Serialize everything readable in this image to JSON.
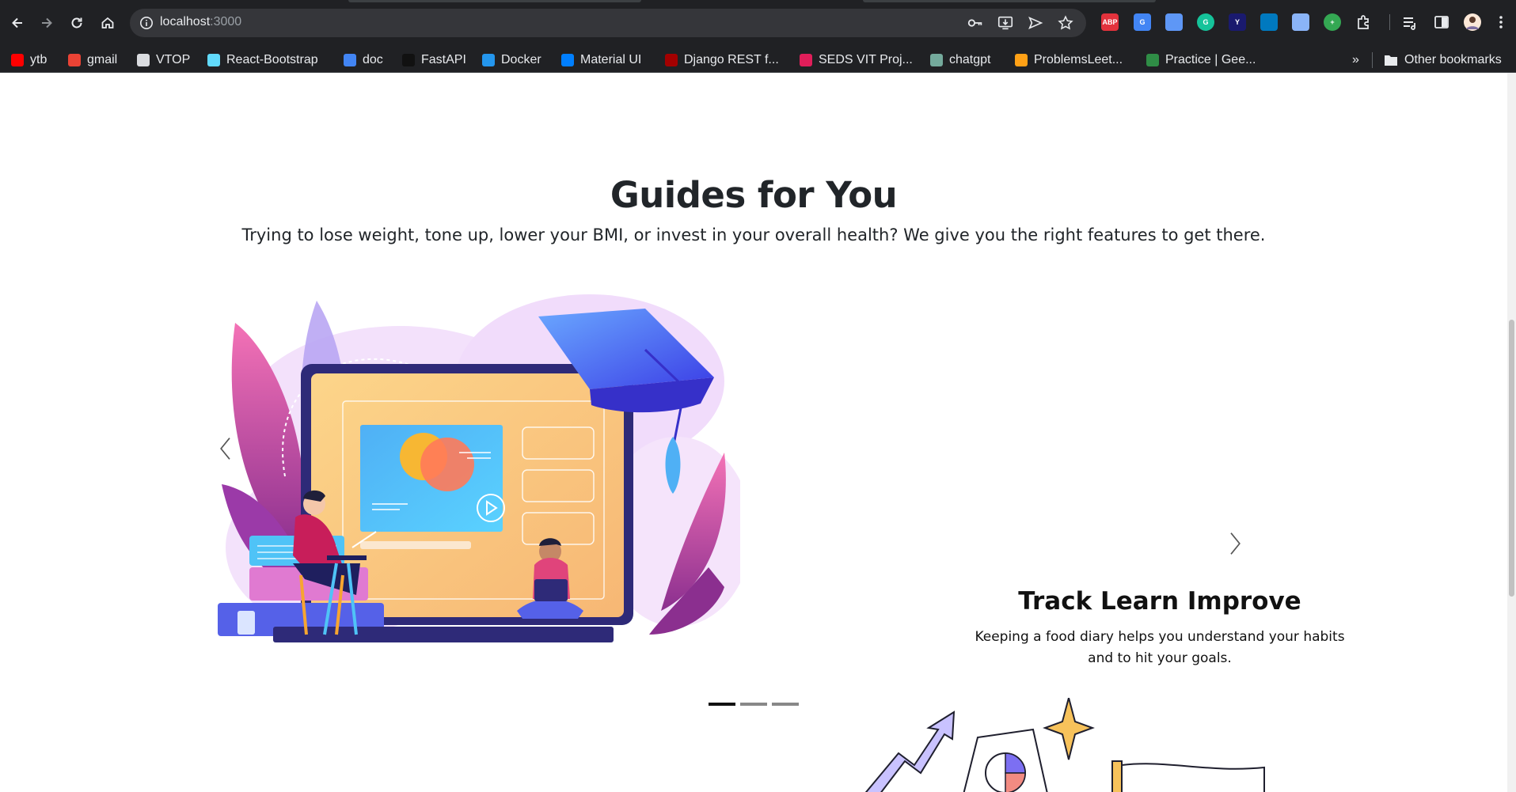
{
  "browser": {
    "url_host": "localhost",
    "url_port": ":3000",
    "bookmarks": [
      {
        "label": "ytb",
        "color": "#ff0000"
      },
      {
        "label": "gmail",
        "color": "#ea4335"
      },
      {
        "label": "VTOP",
        "color": "#dadce0"
      },
      {
        "label": "React-Bootstrap",
        "color": "#61dafb"
      },
      {
        "label": "doc",
        "color": "#4285f4"
      },
      {
        "label": "FastAPI",
        "color": "#111111"
      },
      {
        "label": "Docker",
        "color": "#2496ed"
      },
      {
        "label": "Material UI",
        "color": "#007fff"
      },
      {
        "label": "Django REST f...",
        "color": "#a30000"
      },
      {
        "label": "SEDS VIT Proj...",
        "color": "#e01e5a"
      },
      {
        "label": "chatgpt",
        "color": "#74aa9c"
      },
      {
        "label": "ProblemsLeet...",
        "color": "#ffa116"
      },
      {
        "label": "Practice | Gee...",
        "color": "#2f8d46"
      }
    ],
    "bookmarks_overflow": "»",
    "other_bookmarks": "Other bookmarks",
    "extensions": [
      {
        "name": "abp-icon",
        "label": "ABP",
        "color": "#e2323c"
      },
      {
        "name": "translate-icon",
        "label": "G",
        "color": "#4285f4"
      },
      {
        "name": "screen-capture-icon",
        "label": "",
        "color": "#5e97f6"
      },
      {
        "name": "grammarly-icon",
        "label": "G",
        "color": "#15c39a"
      },
      {
        "name": "y-extension-icon",
        "label": "Y",
        "color": "#1a1a6e"
      },
      {
        "name": "trello-icon",
        "label": "",
        "color": "#0079bf"
      },
      {
        "name": "calendar-icon",
        "label": "",
        "color": "#8ab4f8"
      },
      {
        "name": "add-extension-icon",
        "label": "+",
        "color": "#34a853"
      }
    ]
  },
  "page": {
    "heading": "Guides for You",
    "subheading": "Trying to lose weight, tone up, lower your BMI, or invest in your overall health? We give you the right features to get there.",
    "carousel": {
      "active_index": 0,
      "slide_count": 3,
      "caption_title": "Track Learn Improve",
      "caption_text": "Keeping a food diary helps you understand your habits and to hit your goals."
    }
  }
}
